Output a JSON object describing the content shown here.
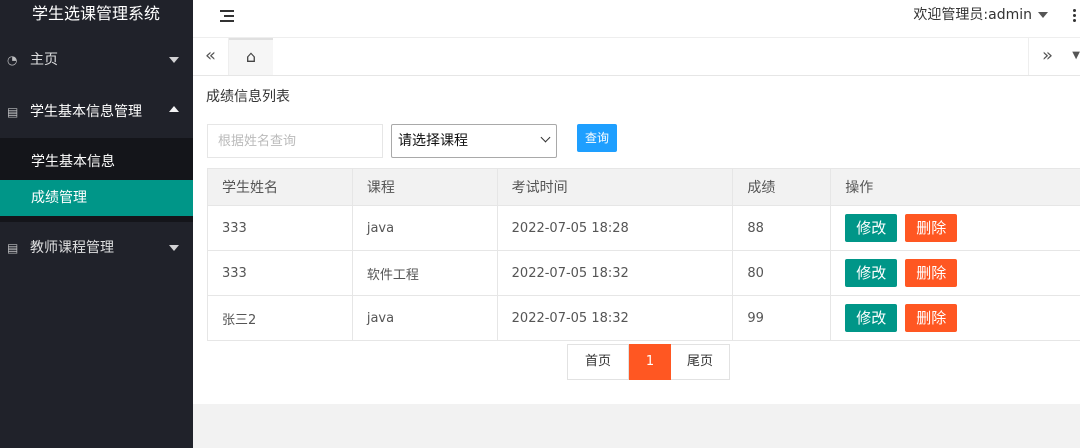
{
  "app": {
    "title": "学生选课管理系统"
  },
  "sidebar": {
    "items": [
      {
        "label": "主页",
        "icon": "gauge-icon",
        "expanded": false
      },
      {
        "label": "学生基本信息管理",
        "icon": "document-icon",
        "expanded": true,
        "children": [
          {
            "label": "学生基本信息",
            "active": false
          },
          {
            "label": "成绩管理",
            "active": true
          }
        ]
      },
      {
        "label": "教师课程管理",
        "icon": "document-icon",
        "expanded": false
      }
    ]
  },
  "header": {
    "welcome": "欢迎管理员:admin"
  },
  "tabs": {
    "prev_glyph": "«",
    "home_glyph": "⌂",
    "next_glyph": "»"
  },
  "card": {
    "title": "成绩信息列表",
    "search_placeholder": "根据姓名查询",
    "select_value": "请选择课程",
    "query_label": "查询"
  },
  "table": {
    "headers": [
      "学生姓名",
      "课程",
      "考试时间",
      "成绩",
      "操作"
    ],
    "rows": [
      {
        "name": "333",
        "course": "java",
        "time": "2022-07-05 18:28",
        "score": "88"
      },
      {
        "name": "333",
        "course": "软件工程",
        "time": "2022-07-05 18:32",
        "score": "80"
      },
      {
        "name": "张三2",
        "course": "java",
        "time": "2022-07-05 18:32",
        "score": "99"
      }
    ],
    "edit_label": "修改",
    "delete_label": "删除"
  },
  "pager": {
    "first": "首页",
    "current": "1",
    "last": "尾页"
  },
  "colors": {
    "sidebar_bg": "#20222a",
    "active": "#009688",
    "danger": "#ff5722",
    "primary": "#1e9fff"
  }
}
